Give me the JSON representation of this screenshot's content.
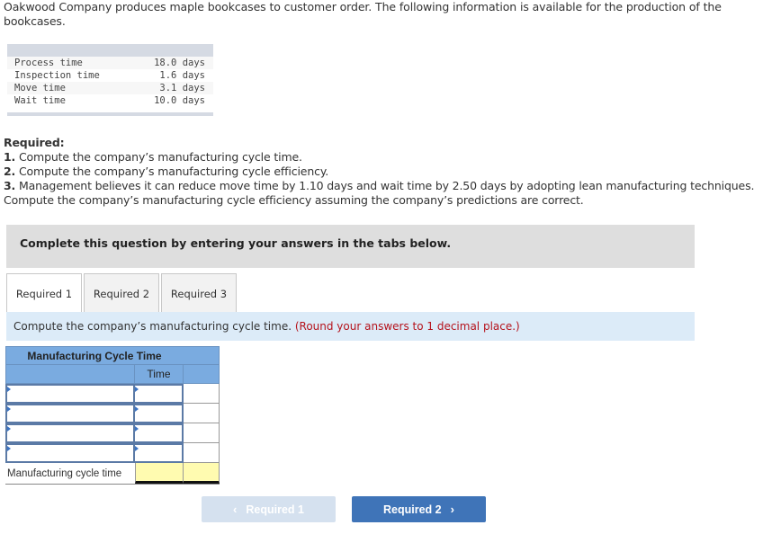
{
  "intro": "Oakwood Company produces maple bookcases to customer order. The following information is available for the production of the bookcases.",
  "given_data": [
    {
      "label": "Process time",
      "value": "18.0 days"
    },
    {
      "label": "Inspection time",
      "value": " 1.6 days"
    },
    {
      "label": "Move time",
      "value": " 3.1 days"
    },
    {
      "label": "Wait time",
      "value": "10.0 days"
    }
  ],
  "required": {
    "heading": "Required:",
    "items": [
      {
        "num": "1.",
        "text": " Compute the company’s manufacturing cycle time."
      },
      {
        "num": "2.",
        "text": " Compute the company’s manufacturing cycle efficiency."
      },
      {
        "num": "3.",
        "text": " Management believes it can reduce move time by 1.10 days and wait time by 2.50 days by adopting lean manufacturing techniques. Compute the company’s manufacturing cycle efficiency assuming the company’s predictions are correct."
      }
    ]
  },
  "banner": "Complete this question by entering your answers in the tabs below.",
  "tabs": [
    {
      "label": "Required 1",
      "active": true
    },
    {
      "label": "Required 2",
      "active": false
    },
    {
      "label": "Required 3",
      "active": false
    }
  ],
  "instruction": {
    "text": "Compute the company’s manufacturing cycle time. ",
    "hint": "(Round your answers to 1 decimal place.)"
  },
  "table": {
    "title": "Manufacturing Cycle Time",
    "column_header": "Time",
    "rows": [
      {
        "label": "",
        "value": ""
      },
      {
        "label": "",
        "value": ""
      },
      {
        "label": "",
        "value": ""
      },
      {
        "label": "",
        "value": ""
      }
    ],
    "total_label": "Manufacturing cycle time",
    "total_value": ""
  },
  "nav": {
    "prev_label": "Required 1",
    "next_label": "Required 2",
    "prev_icon": "chevron-left-icon",
    "next_icon": "chevron-right-icon"
  }
}
